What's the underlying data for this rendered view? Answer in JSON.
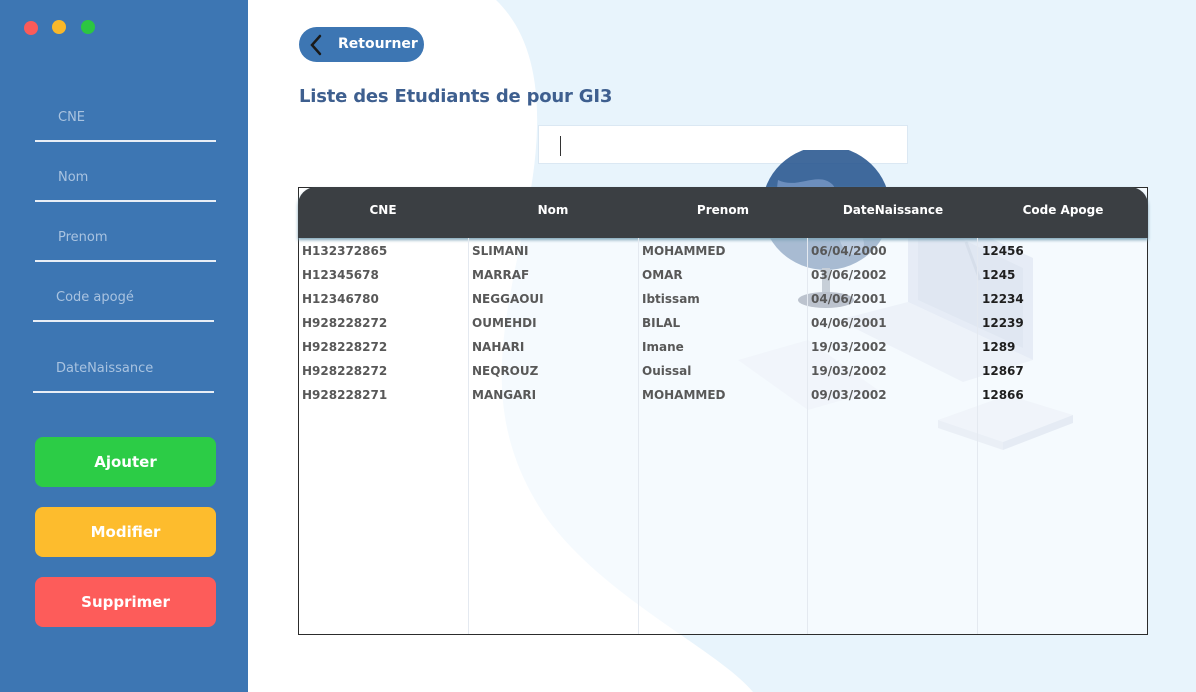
{
  "window": {
    "colors": {
      "close": "#fb5b59",
      "minimize": "#f9b82a",
      "maximize": "#2cc641"
    }
  },
  "sidebar": {
    "fields": {
      "cne": "CNE",
      "nom": "Nom",
      "prenom": "Prenom",
      "code_apoge": "Code apogé",
      "date_naissance": "DateNaissance"
    },
    "buttons": {
      "add": "Ajouter",
      "modify": "Modifier",
      "delete": "Supprimer"
    },
    "colors": {
      "background": "#3d76b3",
      "add": "#2ccc46",
      "modify": "#fdbc2d",
      "delete": "#fd5c5a"
    }
  },
  "header": {
    "back_label": "Retourner",
    "title": "Liste des Etudiants de  pour GI3"
  },
  "search": {
    "value": ""
  },
  "table": {
    "columns": [
      "CNE",
      "Nom",
      "Prenom",
      "DateNaissance",
      "Code Apoge"
    ],
    "rows": [
      [
        "H132372865",
        "SLIMANI",
        "MOHAMMED",
        "06/04/2000",
        "12456"
      ],
      [
        "H12345678",
        "MARRAF",
        "OMAR",
        "03/06/2002",
        "1245"
      ],
      [
        "H12346780",
        "NEGGAOUI",
        "Ibtissam",
        "04/06/2001",
        "12234"
      ],
      [
        "H928228272",
        "OUMEHDI",
        "BILAL",
        "04/06/2001",
        "12239"
      ],
      [
        "H928228272",
        "NAHARI",
        "Imane",
        "19/03/2002",
        "1289"
      ],
      [
        "H928228272",
        "NEQROUZ",
        "Ouissal",
        "19/03/2002",
        "12867"
      ],
      [
        "H928228271",
        "MANGARI",
        "MOHAMMED",
        "09/03/2002",
        "12866"
      ]
    ]
  }
}
